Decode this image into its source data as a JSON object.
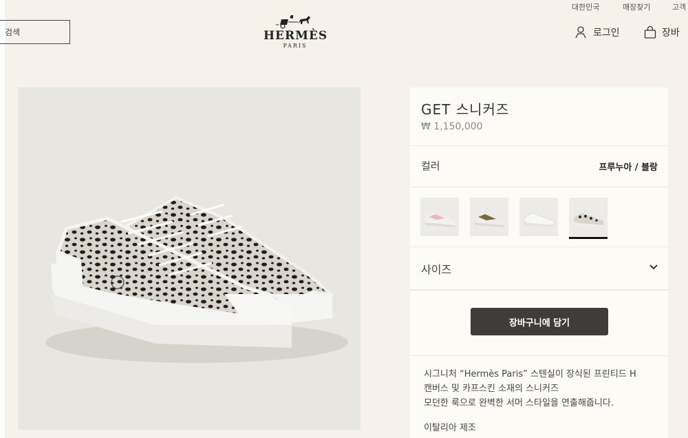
{
  "utility": {
    "region": "대한민국",
    "stores": "매장찾기",
    "service": "고객"
  },
  "header": {
    "search_label": "검색",
    "logo_word": "HERMÈS",
    "logo_sub": "PARIS",
    "login": "로그인",
    "cart": "장바"
  },
  "product": {
    "title": "GET 스니커즈",
    "price": "₩ 1,150,000",
    "color_label": "컬러",
    "color_value": "프루누아 / 블랑",
    "size_label": "사이즈",
    "add_to_cart": "장바구니에 담기",
    "description": [
      "시그니처 “Hermès Paris” 스텐실이 장식된 프린티드 H",
      "캔버스 및 카프스킨 소재의 스니커즈",
      "모던한 룩으로 완벽한 서머 스타일을 연출해줍니다."
    ],
    "origin": "이탈리아 제조"
  },
  "swatches": [
    {
      "name": "pink-variant",
      "accent": "#e8b9c0",
      "selected": false
    },
    {
      "name": "khaki-variant",
      "accent": "#7a6a3a",
      "selected": false
    },
    {
      "name": "white-variant",
      "accent": "#d8d8d8",
      "selected": false
    },
    {
      "name": "leopard-variant",
      "accent": "#2b2b2b",
      "selected": true
    }
  ],
  "colors": {
    "background": "#f6f1eb",
    "panel": "#fdfbf6",
    "button": "#3e3d3b",
    "image_bg": "#e8e6e0"
  }
}
